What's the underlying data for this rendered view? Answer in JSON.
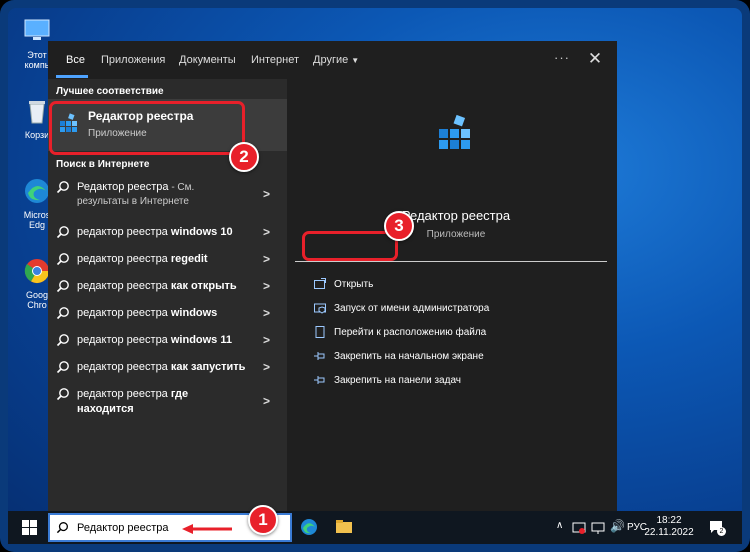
{
  "desktop": {
    "icons": [
      {
        "label": "Этот компь",
        "kind": "pc"
      },
      {
        "label": "Корзи",
        "kind": "recycle"
      },
      {
        "label": "Micros Edg",
        "kind": "edge"
      },
      {
        "label": "Goog Chro",
        "kind": "chrome"
      }
    ]
  },
  "search_panel": {
    "tabs": [
      {
        "label": "Все",
        "active": true
      },
      {
        "label": "Приложения"
      },
      {
        "label": "Документы"
      },
      {
        "label": "Интернет"
      },
      {
        "label": "Другие"
      }
    ],
    "more_menu": "···",
    "close": "✕",
    "best_match_title": "Лучшее соответствие",
    "best_match": {
      "name": "Редактор реестра",
      "type": "Приложение"
    },
    "web_title": "Поиск в Интернете",
    "web_results": [
      {
        "prefix": "Редактор реестра",
        "bold": "",
        "suffix": " - См.",
        "second_line": "результаты в Интернете"
      },
      {
        "prefix": "редактор реестра ",
        "bold": "windows 10"
      },
      {
        "prefix": "редактор реестра ",
        "bold": "regedit"
      },
      {
        "prefix": "редактор реестра ",
        "bold": "как открыть"
      },
      {
        "prefix": "редактор реестра ",
        "bold": "windows"
      },
      {
        "prefix": "редактор реестра ",
        "bold": "windows 11"
      },
      {
        "prefix": "редактор реестра ",
        "bold": "как запустить"
      },
      {
        "prefix": "редактор реестра ",
        "bold": "где",
        "second_line": "находится"
      }
    ],
    "preview": {
      "name": "Редактор реестра",
      "type": "Приложение",
      "actions": [
        {
          "label": "Открыть",
          "icon": "open-icon"
        },
        {
          "label": "Запуск от имени администратора",
          "icon": "shield-icon"
        },
        {
          "label": "Перейти к расположению файла",
          "icon": "file-location-icon"
        },
        {
          "label": "Закрепить на начальном экране",
          "icon": "pin-icon"
        },
        {
          "label": "Закрепить на панели задач",
          "icon": "pin-icon"
        }
      ]
    }
  },
  "annotations": {
    "badge_1": "1",
    "badge_2": "2",
    "badge_3": "3",
    "highlight_color": "#e8202a"
  },
  "taskbar": {
    "search_value": "Редактор реестра",
    "language": "РУС",
    "time": "18:22",
    "date": "22.11.2022",
    "notification_count": "2"
  },
  "colors": {
    "accent": "#4ea3ff",
    "panel": "#1f1f1f",
    "list": "#2b2b2b",
    "selection": "#3c3c3c"
  }
}
